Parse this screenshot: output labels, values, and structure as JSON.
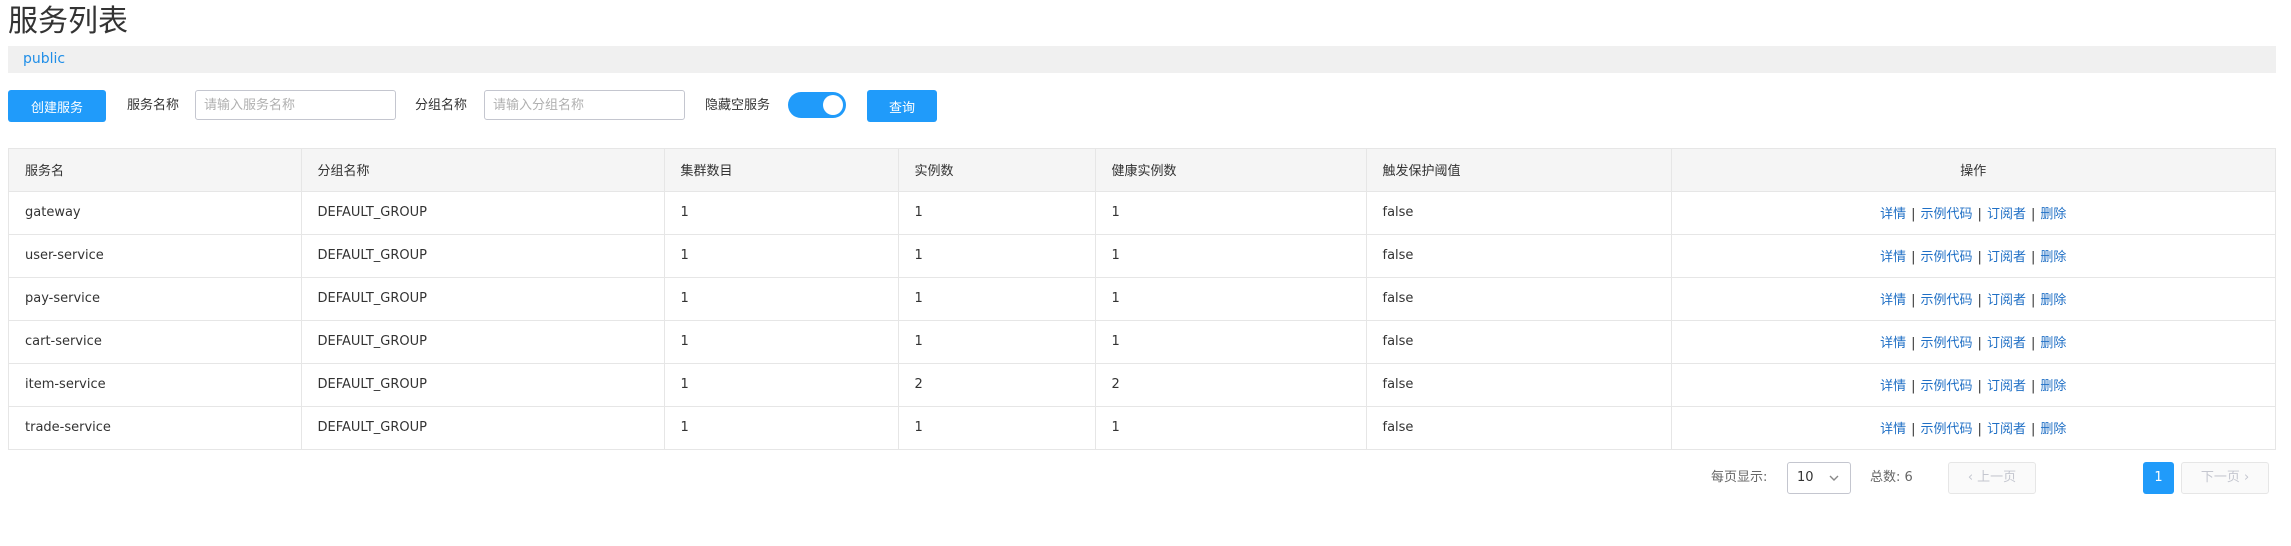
{
  "page_title": "服务列表",
  "namespace": {
    "label": "public"
  },
  "toolbar": {
    "create_label": "创建服务",
    "service_name_label": "服务名称",
    "service_name_placeholder": "请输入服务名称",
    "group_name_label": "分组名称",
    "group_name_placeholder": "请输入分组名称",
    "hide_empty_label": "隐藏空服务",
    "hide_empty_on": true,
    "query_label": "查询"
  },
  "table": {
    "headers": [
      "服务名",
      "分组名称",
      "集群数目",
      "实例数",
      "健康实例数",
      "触发保护阈值",
      "操作"
    ],
    "rows": [
      [
        "gateway",
        "DEFAULT_GROUP",
        "1",
        "1",
        "1",
        "false"
      ],
      [
        "user-service",
        "DEFAULT_GROUP",
        "1",
        "1",
        "1",
        "false"
      ],
      [
        "pay-service",
        "DEFAULT_GROUP",
        "1",
        "1",
        "1",
        "false"
      ],
      [
        "cart-service",
        "DEFAULT_GROUP",
        "1",
        "1",
        "1",
        "false"
      ],
      [
        "item-service",
        "DEFAULT_GROUP",
        "1",
        "2",
        "2",
        "false"
      ],
      [
        "trade-service",
        "DEFAULT_GROUP",
        "1",
        "1",
        "1",
        "false"
      ]
    ],
    "operations": {
      "detail": "详情",
      "sample": "示例代码",
      "subscriber": "订阅者",
      "delete": "删除",
      "separator": "|"
    }
  },
  "pagination": {
    "per_page_label": "每页显示:",
    "page_size": "10",
    "total_label": "总数: 6",
    "prev_label": "上一页",
    "current_page": "1",
    "next_label": "下一页"
  },
  "colors": {
    "primary": "#209bfa",
    "link": "#1f6fc5"
  }
}
